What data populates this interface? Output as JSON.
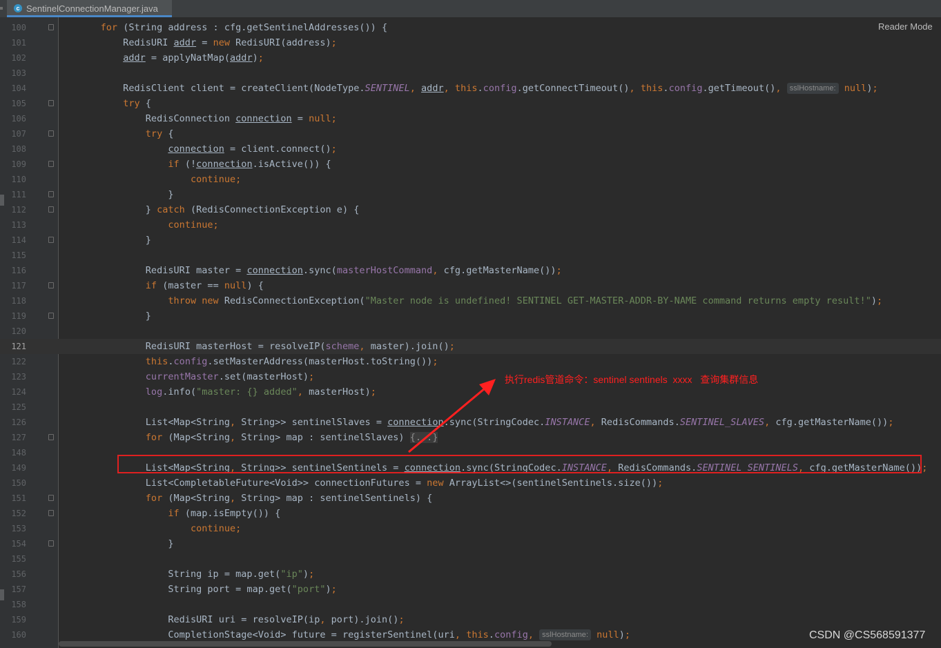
{
  "tab": {
    "icon": "class-icon",
    "filename": "SentinelConnectionManager.java"
  },
  "editor": {
    "reader_mode": "Reader Mode",
    "current_line": "121"
  },
  "lines": [
    {
      "n": "100",
      "fold": true,
      "parts": [
        [
          "    ",
          ""
        ],
        [
          "for ",
          "k"
        ],
        [
          "(String address : cfg.getSentinelAddresses()) {",
          ""
        ]
      ]
    },
    {
      "n": "101",
      "parts": [
        [
          "        RedisURI ",
          ""
        ],
        [
          "addr",
          "u"
        ],
        [
          " = ",
          ""
        ],
        [
          "new ",
          "k"
        ],
        [
          "RedisURI(address)",
          ""
        ],
        [
          ";",
          "k"
        ]
      ]
    },
    {
      "n": "102",
      "parts": [
        [
          "        ",
          ""
        ],
        [
          "addr",
          "u"
        ],
        [
          " = applyNatMap(",
          ""
        ],
        [
          "addr",
          "u"
        ],
        [
          ")",
          ""
        ],
        [
          ";",
          "k"
        ]
      ]
    },
    {
      "n": "103",
      "parts": []
    },
    {
      "n": "104",
      "parts": [
        [
          "        RedisClient client = createClient(NodeType.",
          ""
        ],
        [
          "SENTINEL",
          "pi"
        ],
        [
          ", ",
          "k"
        ],
        [
          "addr",
          "u"
        ],
        [
          ", ",
          "k"
        ],
        [
          "this",
          "k"
        ],
        [
          ".",
          ""
        ],
        [
          "config",
          "p"
        ],
        [
          ".getConnectTimeout()",
          ""
        ],
        [
          ", ",
          "k"
        ],
        [
          "this",
          "k"
        ],
        [
          ".",
          ""
        ],
        [
          "config",
          "p"
        ],
        [
          ".getTimeout()",
          ""
        ],
        [
          ", ",
          "k"
        ],
        [
          "sslHostname:",
          "hint"
        ],
        [
          " null",
          "k"
        ],
        [
          ")",
          ""
        ],
        [
          ";",
          "k"
        ]
      ]
    },
    {
      "n": "105",
      "fold": true,
      "parts": [
        [
          "        ",
          ""
        ],
        [
          "try ",
          "k"
        ],
        [
          "{",
          ""
        ]
      ]
    },
    {
      "n": "106",
      "parts": [
        [
          "            RedisConnection ",
          ""
        ],
        [
          "connection",
          "u"
        ],
        [
          " = ",
          ""
        ],
        [
          "null",
          "k"
        ],
        [
          ";",
          "k"
        ]
      ]
    },
    {
      "n": "107",
      "fold": true,
      "parts": [
        [
          "            ",
          ""
        ],
        [
          "try ",
          "k"
        ],
        [
          "{",
          ""
        ]
      ]
    },
    {
      "n": "108",
      "parts": [
        [
          "                ",
          ""
        ],
        [
          "connection",
          "u"
        ],
        [
          " = client.connect()",
          ""
        ],
        [
          ";",
          "k"
        ]
      ]
    },
    {
      "n": "109",
      "fold": true,
      "parts": [
        [
          "                ",
          ""
        ],
        [
          "if ",
          "k"
        ],
        [
          "(!",
          ""
        ],
        [
          "connection",
          "u"
        ],
        [
          ".isActive()) {",
          ""
        ]
      ]
    },
    {
      "n": "110",
      "parts": [
        [
          "                    ",
          ""
        ],
        [
          "continue;",
          "k"
        ]
      ]
    },
    {
      "n": "111",
      "fold": true,
      "parts": [
        [
          "                }",
          ""
        ]
      ]
    },
    {
      "n": "112",
      "fold": true,
      "parts": [
        [
          "            } ",
          ""
        ],
        [
          "catch ",
          "k"
        ],
        [
          "(RedisConnectionException e) {",
          ""
        ]
      ]
    },
    {
      "n": "113",
      "parts": [
        [
          "                ",
          ""
        ],
        [
          "continue;",
          "k"
        ]
      ]
    },
    {
      "n": "114",
      "fold": true,
      "parts": [
        [
          "            }",
          ""
        ]
      ]
    },
    {
      "n": "115",
      "parts": []
    },
    {
      "n": "116",
      "parts": [
        [
          "            RedisURI master = ",
          ""
        ],
        [
          "connection",
          "u"
        ],
        [
          ".sync(",
          ""
        ],
        [
          "masterHostCommand",
          "p"
        ],
        [
          ", ",
          "k"
        ],
        [
          "cfg.getMasterName())",
          ""
        ],
        [
          ";",
          "k"
        ]
      ]
    },
    {
      "n": "117",
      "fold": true,
      "parts": [
        [
          "            ",
          ""
        ],
        [
          "if ",
          "k"
        ],
        [
          "(master == ",
          ""
        ],
        [
          "null",
          "k"
        ],
        [
          ") {",
          ""
        ]
      ]
    },
    {
      "n": "118",
      "parts": [
        [
          "                ",
          ""
        ],
        [
          "throw new ",
          "k"
        ],
        [
          "RedisConnectionException(",
          ""
        ],
        [
          "\"Master node is undefined! SENTINEL GET-MASTER-ADDR-BY-NAME command returns empty result!\"",
          "s"
        ],
        [
          ")",
          ""
        ],
        [
          ";",
          "k"
        ]
      ]
    },
    {
      "n": "119",
      "fold": true,
      "parts": [
        [
          "            }",
          ""
        ]
      ]
    },
    {
      "n": "120",
      "parts": []
    },
    {
      "n": "121",
      "parts": [
        [
          "            RedisURI masterHost = resolveIP(",
          ""
        ],
        [
          "scheme",
          "p"
        ],
        [
          ", ",
          "k"
        ],
        [
          "master).join()",
          ""
        ],
        [
          ";",
          "k"
        ]
      ]
    },
    {
      "n": "122",
      "parts": [
        [
          "            ",
          ""
        ],
        [
          "this",
          "k"
        ],
        [
          ".",
          ""
        ],
        [
          "config",
          "p"
        ],
        [
          ".setMasterAddress(masterHost.toString())",
          ""
        ],
        [
          ";",
          "k"
        ]
      ]
    },
    {
      "n": "123",
      "parts": [
        [
          "            ",
          ""
        ],
        [
          "currentMaster",
          "p"
        ],
        [
          ".set(masterHost)",
          ""
        ],
        [
          ";",
          "k"
        ]
      ]
    },
    {
      "n": "124",
      "parts": [
        [
          "            ",
          ""
        ],
        [
          "log",
          "p"
        ],
        [
          ".info(",
          ""
        ],
        [
          "\"master: {} added\"",
          "s"
        ],
        [
          ", ",
          "k"
        ],
        [
          "masterHost)",
          ""
        ],
        [
          ";",
          "k"
        ]
      ]
    },
    {
      "n": "125",
      "parts": []
    },
    {
      "n": "126",
      "parts": [
        [
          "            List<Map<String",
          ""
        ],
        [
          ", ",
          "k"
        ],
        [
          "String>> sentinelSlaves = ",
          ""
        ],
        [
          "connection",
          "u"
        ],
        [
          ".sync(StringCodec.",
          ""
        ],
        [
          "INSTANCE",
          "pi"
        ],
        [
          ", ",
          "k"
        ],
        [
          "RedisCommands.",
          ""
        ],
        [
          "SENTINEL_SLAVES",
          "pi"
        ],
        [
          ", ",
          "k"
        ],
        [
          "cfg.getMasterName())",
          ""
        ],
        [
          ";",
          "k"
        ]
      ]
    },
    {
      "n": "127",
      "fold": true,
      "parts": [
        [
          "            ",
          ""
        ],
        [
          "for ",
          "k"
        ],
        [
          "(Map<String",
          ""
        ],
        [
          ", ",
          "k"
        ],
        [
          "String> map : sentinelSlaves) ",
          ""
        ],
        [
          "{...}",
          "collapsed"
        ]
      ]
    },
    {
      "n": "148",
      "parts": []
    },
    {
      "n": "149",
      "parts": [
        [
          "            List<Map<String",
          ""
        ],
        [
          ", ",
          "k"
        ],
        [
          "String>> sentinelSentinels = ",
          ""
        ],
        [
          "connection",
          "u"
        ],
        [
          ".sync(StringCodec.",
          ""
        ],
        [
          "INSTANCE",
          "pi"
        ],
        [
          ", ",
          "k"
        ],
        [
          "RedisCommands.",
          ""
        ],
        [
          "SENTINEL_SENTINELS",
          "pi"
        ],
        [
          ", ",
          "k"
        ],
        [
          "cfg.getMasterName())",
          ""
        ],
        [
          ";",
          "k"
        ]
      ]
    },
    {
      "n": "150",
      "parts": [
        [
          "            List<CompletableFuture<Void>> connectionFutures = ",
          ""
        ],
        [
          "new ",
          "k"
        ],
        [
          "ArrayList<>(sentinelSentinels.size())",
          ""
        ],
        [
          ";",
          "k"
        ]
      ]
    },
    {
      "n": "151",
      "fold": true,
      "parts": [
        [
          "            ",
          ""
        ],
        [
          "for ",
          "k"
        ],
        [
          "(Map<String",
          ""
        ],
        [
          ", ",
          "k"
        ],
        [
          "String> map : sentinelSentinels) {",
          ""
        ]
      ]
    },
    {
      "n": "152",
      "fold": true,
      "parts": [
        [
          "                ",
          ""
        ],
        [
          "if ",
          "k"
        ],
        [
          "(map.isEmpty()) {",
          ""
        ]
      ]
    },
    {
      "n": "153",
      "parts": [
        [
          "                    ",
          ""
        ],
        [
          "continue;",
          "k"
        ]
      ]
    },
    {
      "n": "154",
      "fold": true,
      "parts": [
        [
          "                }",
          ""
        ]
      ]
    },
    {
      "n": "155",
      "parts": []
    },
    {
      "n": "156",
      "parts": [
        [
          "                String ip = map.get(",
          ""
        ],
        [
          "\"ip\"",
          "s"
        ],
        [
          ")",
          ""
        ],
        [
          ";",
          "k"
        ]
      ]
    },
    {
      "n": "157",
      "parts": [
        [
          "                String port = map.get(",
          ""
        ],
        [
          "\"port\"",
          "s"
        ],
        [
          ")",
          ""
        ],
        [
          ";",
          "k"
        ]
      ]
    },
    {
      "n": "158",
      "parts": []
    },
    {
      "n": "159",
      "parts": [
        [
          "                RedisURI uri = resolveIP(ip",
          ""
        ],
        [
          ", ",
          "k"
        ],
        [
          "port).join()",
          ""
        ],
        [
          ";",
          "k"
        ]
      ]
    },
    {
      "n": "160",
      "parts": [
        [
          "                CompletionStage<Void> future = registerSentinel(uri",
          ""
        ],
        [
          ", ",
          "k"
        ],
        [
          "this",
          "k"
        ],
        [
          ".",
          ""
        ],
        [
          "config",
          "p"
        ],
        [
          ", ",
          "k"
        ],
        [
          "sslHostname:",
          "hint"
        ],
        [
          " null",
          "k"
        ],
        [
          ")",
          ""
        ],
        [
          ";",
          "k"
        ]
      ]
    }
  ],
  "annotation": {
    "text": "执行redis管道命令：sentinel sentinels  xxxx   查询集群信息",
    "color": "#e02020"
  },
  "highlight": {
    "line": "149",
    "color": "#e02020"
  },
  "watermark": "CSDN @CS568591377"
}
